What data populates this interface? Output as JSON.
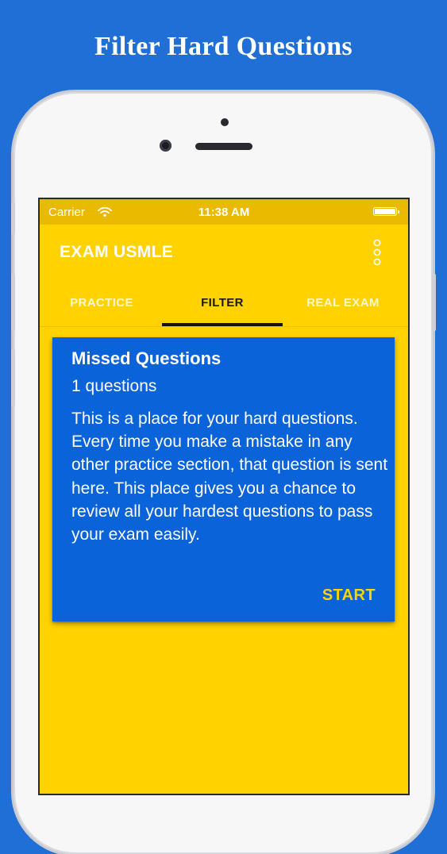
{
  "promo": {
    "title": "Filter Hard Questions"
  },
  "colors": {
    "background": "#1f6fd6",
    "app_bar": "#ffd200",
    "status_bar": "#e9ba00",
    "card": "#0a63d8",
    "accent": "#ffd200"
  },
  "status_bar": {
    "carrier": "Carrier",
    "time": "11:38 AM",
    "wifi_icon": "wifi-icon",
    "battery_icon": "battery-icon"
  },
  "app_bar": {
    "title": "EXAM USMLE",
    "menu_icon": "more-vertical-icon"
  },
  "tabs": [
    {
      "label": "PRACTICE",
      "active": false
    },
    {
      "label": "FILTER",
      "active": true
    },
    {
      "label": "REAL EXAM",
      "active": false
    }
  ],
  "card": {
    "title": "Missed Questions",
    "count": "1 questions",
    "description": "This is a place for your hard questions. Every time you make a mistake in any other practice section, that question is sent here. This place gives you a chance to review all your hardest questions to pass your exam easily.",
    "action": "START"
  }
}
